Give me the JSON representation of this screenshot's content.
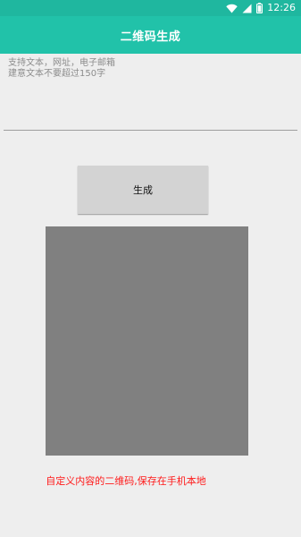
{
  "status_bar": {
    "time": "12:26",
    "icons": [
      "wifi-icon",
      "signal-icon",
      "battery-icon"
    ],
    "color": "#1fb79f"
  },
  "app_bar": {
    "title": "二维码生成",
    "color": "#21c2a9"
  },
  "input": {
    "placeholder": "支持文本，网址，电子邮箱\n建意文本不要超过150字",
    "value": ""
  },
  "generate_button": {
    "label": "生成"
  },
  "qr_preview": {
    "color": "#808080"
  },
  "footer": {
    "note": "自定义内容的二维码,保存在手机本地",
    "color": "#ff1a1a"
  }
}
